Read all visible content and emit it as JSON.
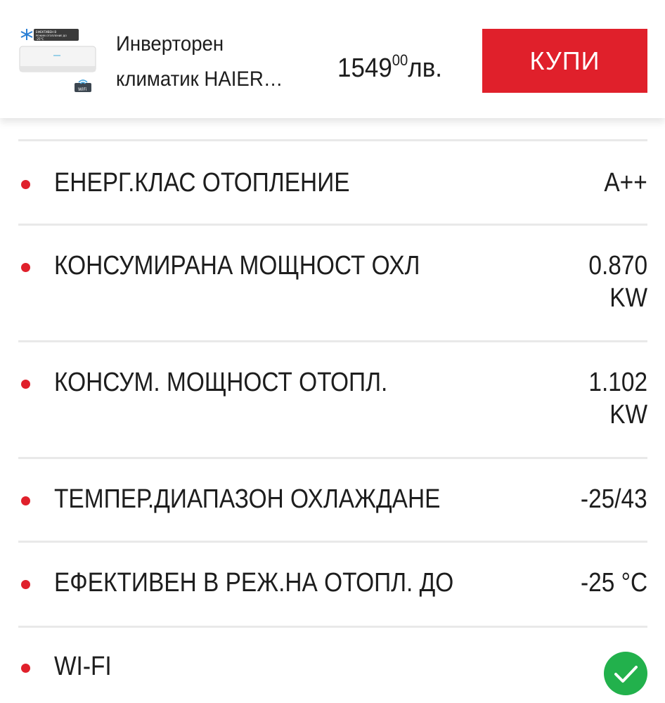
{
  "header": {
    "title_line1": "Инверторен",
    "title_line2": "климатик HAIER…",
    "price_main": "1549",
    "price_cents": "00",
    "price_currency": "лв.",
    "buy_label": "КУПИ",
    "thumb_badge": "ЕФЕКТИВЕН В\nРЕЖИМ ОТОПЛЕНИЕ ДО\n-25°C",
    "wifi_badge": "WiFi"
  },
  "specs": [
    {
      "label": "ЕНЕРГ.КЛАС ОТОПЛЕНИЕ",
      "value": "A++"
    },
    {
      "label": "КОНСУМИРАНА МОЩНОСТ ОХЛ",
      "value": "0.870\nKW"
    },
    {
      "label": "КОНСУМ. МОЩНОСТ ОТОПЛ.",
      "value": "1.102\nKW"
    },
    {
      "label": "ТЕМПЕР.ДИАПАЗОН ОХЛАЖДАНЕ",
      "value": "-25/43"
    },
    {
      "label": "ЕФЕКТИВЕН В РЕЖ.НА ОТОПЛ. ДО",
      "value": "-25 °C"
    },
    {
      "label": "WI-FI",
      "value_icon": "check-icon"
    }
  ],
  "colors": {
    "accent_red": "#e0202b",
    "check_green": "#22b14c",
    "divider": "#e9e9e9"
  }
}
